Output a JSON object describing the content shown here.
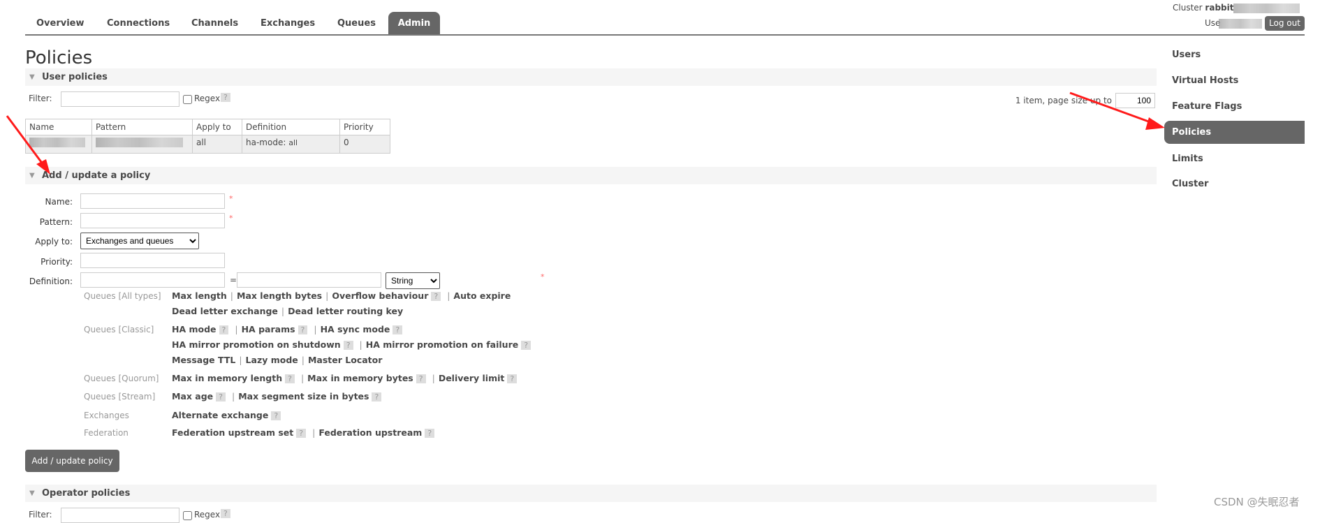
{
  "nav": {
    "tabs": [
      "Overview",
      "Connections",
      "Channels",
      "Exchanges",
      "Queues",
      "Admin"
    ],
    "active": "Admin"
  },
  "header": {
    "cluster_label": "Cluster",
    "cluster_name": "rabbit",
    "user_label": "Use",
    "logout": "Log out"
  },
  "page_title": "Policies",
  "user_policies": {
    "title": "User policies",
    "filter_label": "Filter:",
    "filter_value": "",
    "regex_label": "Regex",
    "help": "?",
    "paging_text": "1 item, page size up to",
    "page_size": "100",
    "columns": [
      "Name",
      "Pattern",
      "Apply to",
      "Definition",
      "Priority"
    ],
    "rows": [
      {
        "apply_to": "all",
        "definition_key": "ha-mode:",
        "definition_value": "all",
        "priority": "0"
      }
    ]
  },
  "add_policy": {
    "title": "Add / update a policy",
    "name_label": "Name:",
    "pattern_label": "Pattern:",
    "apply_label": "Apply to:",
    "apply_value": "Exchanges and queues",
    "priority_label": "Priority:",
    "definition_label": "Definition:",
    "equals": "=",
    "type_value": "String",
    "required": "*",
    "help_groups": [
      {
        "category": "Queues [All types]",
        "lines": [
          [
            [
              "Max length",
              false
            ],
            [
              "Max length bytes",
              false
            ],
            [
              "Overflow behaviour",
              true
            ],
            [
              "Auto expire",
              false
            ]
          ],
          [
            [
              "Dead letter exchange",
              false
            ],
            [
              "Dead letter routing key",
              false
            ]
          ]
        ]
      },
      {
        "category": "Queues [Classic]",
        "lines": [
          [
            [
              "HA mode",
              true
            ],
            [
              "HA params",
              true
            ],
            [
              "HA sync mode",
              true
            ]
          ],
          [
            [
              "HA mirror promotion on shutdown",
              true
            ],
            [
              "HA mirror promotion on failure",
              true
            ]
          ],
          [
            [
              "Message TTL",
              false
            ],
            [
              "Lazy mode",
              false
            ],
            [
              "Master Locator",
              false
            ]
          ]
        ]
      },
      {
        "category": "Queues [Quorum]",
        "lines": [
          [
            [
              "Max in memory length",
              true
            ],
            [
              "Max in memory bytes",
              true
            ],
            [
              "Delivery limit",
              true
            ]
          ]
        ]
      },
      {
        "category": "Queues [Stream]",
        "lines": [
          [
            [
              "Max age",
              true
            ],
            [
              "Max segment size in bytes",
              true
            ]
          ]
        ]
      },
      {
        "category": "Exchanges",
        "lines": [
          [
            [
              "Alternate exchange",
              true
            ]
          ]
        ]
      },
      {
        "category": "Federation",
        "lines": [
          [
            [
              "Federation upstream set",
              true
            ],
            [
              "Federation upstream",
              true
            ]
          ]
        ]
      }
    ],
    "submit": "Add / update policy"
  },
  "operator_policies": {
    "title": "Operator policies",
    "filter_label": "Filter:",
    "regex_label": "Regex",
    "help": "?"
  },
  "sidebar": {
    "items": [
      "Users",
      "Virtual Hosts",
      "Feature Flags",
      "Policies",
      "Limits",
      "Cluster"
    ],
    "active": "Policies"
  },
  "watermark": "CSDN @失眠忍者",
  "colors": {
    "active_bg": "#666666",
    "section_bg": "#f5f5f5",
    "arrow": "#ff1a1a"
  }
}
